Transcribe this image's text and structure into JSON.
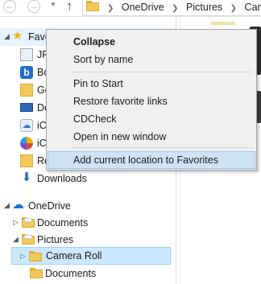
{
  "address": {
    "crumbs": [
      "OneDrive",
      "Pictures",
      "Camera"
    ]
  },
  "nav_pane": {
    "favorites_label": "Favo",
    "favorites_children": [
      {
        "label": "JP",
        "icon": "jpg-file-icon"
      },
      {
        "label": "Bo",
        "icon": "box-icon"
      },
      {
        "label": "Go",
        "icon": "google-drive-icon"
      },
      {
        "label": "De",
        "icon": "desktop-icon"
      },
      {
        "label": "iC",
        "icon": "icloud-icon"
      },
      {
        "label": "iC",
        "icon": "icloud-photos-icon"
      },
      {
        "label": "Re",
        "icon": "recent-places-icon"
      },
      {
        "label": "Downloads",
        "icon": "downloads-icon"
      }
    ],
    "onedrive_label": "OneDrive",
    "onedrive_children": [
      {
        "label": "Documents"
      },
      {
        "label": "Pictures"
      },
      {
        "label": "Camera Roll"
      },
      {
        "label": "Documents"
      }
    ]
  },
  "context_menu": {
    "items": [
      {
        "label": "Collapse"
      },
      {
        "label": "Sort by name"
      },
      {
        "label": "Pin to Start"
      },
      {
        "label": "Restore favorite links"
      },
      {
        "label": "CDCheck"
      },
      {
        "label": "Open in new window"
      },
      {
        "label": "Add current location to Favorites"
      }
    ]
  },
  "colors": {
    "selection": "#cce8ff",
    "menu_hover": "#cfe3f7",
    "folder": "#f1c958"
  }
}
